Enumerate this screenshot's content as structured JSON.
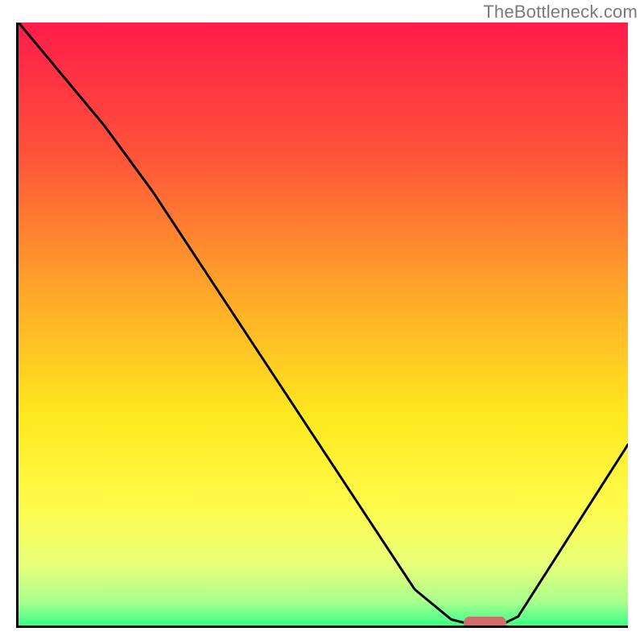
{
  "watermark": "TheBottleneck.com",
  "chart_data": {
    "type": "line",
    "title": "",
    "xlabel": "",
    "ylabel": "",
    "xlim": [
      0,
      100
    ],
    "ylim": [
      0,
      100
    ],
    "grid": false,
    "background": {
      "kind": "vertical-gradient",
      "stops": [
        {
          "offset": 0.0,
          "color": "#ff1c4b"
        },
        {
          "offset": 0.22,
          "color": "#ff5339"
        },
        {
          "offset": 0.45,
          "color": "#ffa829"
        },
        {
          "offset": 0.65,
          "color": "#ffe81e"
        },
        {
          "offset": 0.8,
          "color": "#fffb4a"
        },
        {
          "offset": 0.9,
          "color": "#e8ff7a"
        },
        {
          "offset": 0.96,
          "color": "#a9ff8d"
        },
        {
          "offset": 1.0,
          "color": "#3dff88"
        }
      ]
    },
    "series": [
      {
        "name": "curve",
        "type": "line",
        "color": "#000000",
        "points": [
          {
            "x": 0,
            "y": 100
          },
          {
            "x": 14,
            "y": 83
          },
          {
            "x": 22,
            "y": 72
          },
          {
            "x": 65,
            "y": 6
          },
          {
            "x": 71,
            "y": 1
          },
          {
            "x": 73,
            "y": 0.5
          },
          {
            "x": 80,
            "y": 0.5
          },
          {
            "x": 82,
            "y": 1.5
          },
          {
            "x": 100,
            "y": 30
          }
        ]
      }
    ],
    "marker_bar": {
      "x": 76.5,
      "y": 0.5,
      "width": 7,
      "height": 2,
      "color": "#cf6e6d",
      "shape": "pill"
    }
  }
}
